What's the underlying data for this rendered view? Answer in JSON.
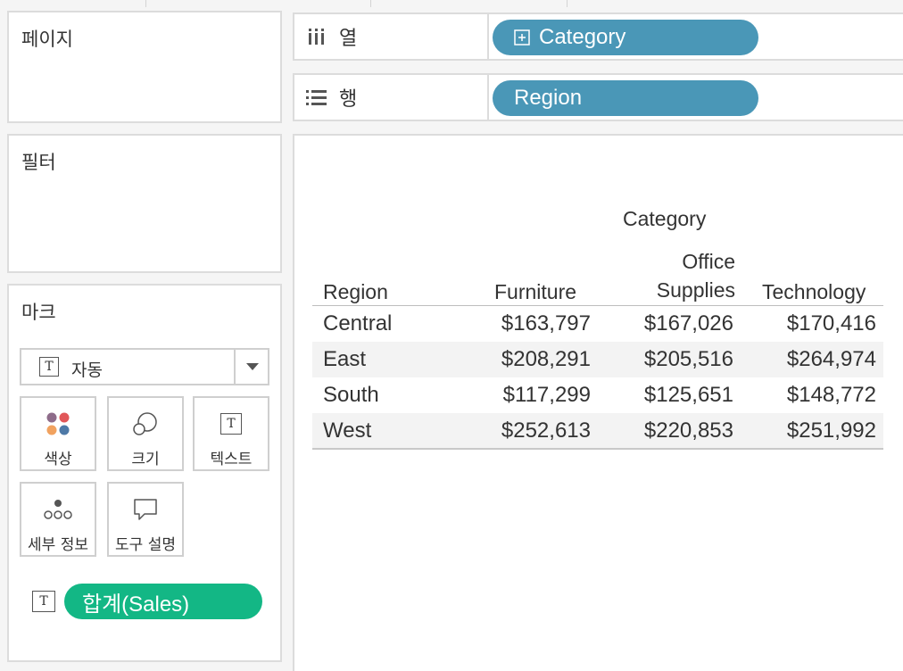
{
  "shelves": {
    "pages_title": "페이지",
    "filters_title": "필터",
    "marks_title": "마크",
    "columns_label": "열",
    "columns_pill": "Category",
    "rows_label": "행",
    "rows_pill": "Region"
  },
  "marks": {
    "type_value": "자동",
    "buttons": {
      "color": "색상",
      "size": "크기",
      "text": "텍스트",
      "detail": "세부 정보",
      "tooltip": "도구 설명"
    },
    "text_pill": "합계(Sales)"
  },
  "view": {
    "column_header": "Category",
    "row_header": "Region",
    "col_furniture": "Furniture",
    "col_office_1": "Office",
    "col_office_2": "Supplies",
    "col_technology": "Technology",
    "rows": [
      {
        "region": "Central",
        "furniture": "$163,797",
        "office": "$167,026",
        "technology": "$170,416"
      },
      {
        "region": "East",
        "furniture": "$208,291",
        "office": "$205,516",
        "technology": "$264,974"
      },
      {
        "region": "South",
        "furniture": "$117,299",
        "office": "$125,651",
        "technology": "$148,772"
      },
      {
        "region": "West",
        "furniture": "$252,613",
        "office": "$220,853",
        "technology": "$251,992"
      }
    ]
  },
  "chart_data": {
    "type": "table",
    "title": "",
    "columns_title": "Category",
    "rows_title": "Region",
    "categories": [
      "Furniture",
      "Office Supplies",
      "Technology"
    ],
    "series": [
      {
        "name": "Central",
        "values": [
          163797,
          167026,
          170416
        ]
      },
      {
        "name": "East",
        "values": [
          208291,
          205516,
          264974
        ]
      },
      {
        "name": "South",
        "values": [
          117299,
          125651,
          148772
        ]
      },
      {
        "name": "West",
        "values": [
          252613,
          220853,
          251992
        ]
      }
    ]
  },
  "colors": {
    "pill_blue": "#4a97b7",
    "pill_green": "#13b785",
    "color_dots": [
      "#8e6c8a",
      "#e15759",
      "#f1a25f",
      "#4e79a7"
    ]
  }
}
